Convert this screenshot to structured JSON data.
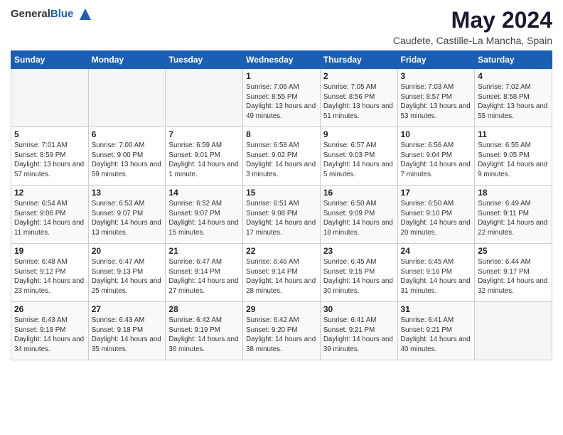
{
  "header": {
    "logo_general": "General",
    "logo_blue": "Blue",
    "month_title": "May 2024",
    "location": "Caudete, Castille-La Mancha, Spain"
  },
  "calendar": {
    "headers": [
      "Sunday",
      "Monday",
      "Tuesday",
      "Wednesday",
      "Thursday",
      "Friday",
      "Saturday"
    ],
    "weeks": [
      [
        {
          "day": "",
          "info": ""
        },
        {
          "day": "",
          "info": ""
        },
        {
          "day": "",
          "info": ""
        },
        {
          "day": "1",
          "info": "Sunrise: 7:06 AM\nSunset: 8:55 PM\nDaylight: 13 hours\nand 49 minutes."
        },
        {
          "day": "2",
          "info": "Sunrise: 7:05 AM\nSunset: 8:56 PM\nDaylight: 13 hours\nand 51 minutes."
        },
        {
          "day": "3",
          "info": "Sunrise: 7:03 AM\nSunset: 8:57 PM\nDaylight: 13 hours\nand 53 minutes."
        },
        {
          "day": "4",
          "info": "Sunrise: 7:02 AM\nSunset: 8:58 PM\nDaylight: 13 hours\nand 55 minutes."
        }
      ],
      [
        {
          "day": "5",
          "info": "Sunrise: 7:01 AM\nSunset: 8:59 PM\nDaylight: 13 hours\nand 57 minutes."
        },
        {
          "day": "6",
          "info": "Sunrise: 7:00 AM\nSunset: 9:00 PM\nDaylight: 13 hours\nand 59 minutes."
        },
        {
          "day": "7",
          "info": "Sunrise: 6:59 AM\nSunset: 9:01 PM\nDaylight: 14 hours\nand 1 minute."
        },
        {
          "day": "8",
          "info": "Sunrise: 6:58 AM\nSunset: 9:02 PM\nDaylight: 14 hours\nand 3 minutes."
        },
        {
          "day": "9",
          "info": "Sunrise: 6:57 AM\nSunset: 9:03 PM\nDaylight: 14 hours\nand 5 minutes."
        },
        {
          "day": "10",
          "info": "Sunrise: 6:56 AM\nSunset: 9:04 PM\nDaylight: 14 hours\nand 7 minutes."
        },
        {
          "day": "11",
          "info": "Sunrise: 6:55 AM\nSunset: 9:05 PM\nDaylight: 14 hours\nand 9 minutes."
        }
      ],
      [
        {
          "day": "12",
          "info": "Sunrise: 6:54 AM\nSunset: 9:06 PM\nDaylight: 14 hours\nand 11 minutes."
        },
        {
          "day": "13",
          "info": "Sunrise: 6:53 AM\nSunset: 9:07 PM\nDaylight: 14 hours\nand 13 minutes."
        },
        {
          "day": "14",
          "info": "Sunrise: 6:52 AM\nSunset: 9:07 PM\nDaylight: 14 hours\nand 15 minutes."
        },
        {
          "day": "15",
          "info": "Sunrise: 6:51 AM\nSunset: 9:08 PM\nDaylight: 14 hours\nand 17 minutes."
        },
        {
          "day": "16",
          "info": "Sunrise: 6:50 AM\nSunset: 9:09 PM\nDaylight: 14 hours\nand 18 minutes."
        },
        {
          "day": "17",
          "info": "Sunrise: 6:50 AM\nSunset: 9:10 PM\nDaylight: 14 hours\nand 20 minutes."
        },
        {
          "day": "18",
          "info": "Sunrise: 6:49 AM\nSunset: 9:11 PM\nDaylight: 14 hours\nand 22 minutes."
        }
      ],
      [
        {
          "day": "19",
          "info": "Sunrise: 6:48 AM\nSunset: 9:12 PM\nDaylight: 14 hours\nand 23 minutes."
        },
        {
          "day": "20",
          "info": "Sunrise: 6:47 AM\nSunset: 9:13 PM\nDaylight: 14 hours\nand 25 minutes."
        },
        {
          "day": "21",
          "info": "Sunrise: 6:47 AM\nSunset: 9:14 PM\nDaylight: 14 hours\nand 27 minutes."
        },
        {
          "day": "22",
          "info": "Sunrise: 6:46 AM\nSunset: 9:14 PM\nDaylight: 14 hours\nand 28 minutes."
        },
        {
          "day": "23",
          "info": "Sunrise: 6:45 AM\nSunset: 9:15 PM\nDaylight: 14 hours\nand 30 minutes."
        },
        {
          "day": "24",
          "info": "Sunrise: 6:45 AM\nSunset: 9:16 PM\nDaylight: 14 hours\nand 31 minutes."
        },
        {
          "day": "25",
          "info": "Sunrise: 6:44 AM\nSunset: 9:17 PM\nDaylight: 14 hours\nand 32 minutes."
        }
      ],
      [
        {
          "day": "26",
          "info": "Sunrise: 6:43 AM\nSunset: 9:18 PM\nDaylight: 14 hours\nand 34 minutes."
        },
        {
          "day": "27",
          "info": "Sunrise: 6:43 AM\nSunset: 9:18 PM\nDaylight: 14 hours\nand 35 minutes."
        },
        {
          "day": "28",
          "info": "Sunrise: 6:42 AM\nSunset: 9:19 PM\nDaylight: 14 hours\nand 36 minutes."
        },
        {
          "day": "29",
          "info": "Sunrise: 6:42 AM\nSunset: 9:20 PM\nDaylight: 14 hours\nand 38 minutes."
        },
        {
          "day": "30",
          "info": "Sunrise: 6:41 AM\nSunset: 9:21 PM\nDaylight: 14 hours\nand 39 minutes."
        },
        {
          "day": "31",
          "info": "Sunrise: 6:41 AM\nSunset: 9:21 PM\nDaylight: 14 hours\nand 40 minutes."
        },
        {
          "day": "",
          "info": ""
        }
      ]
    ]
  }
}
